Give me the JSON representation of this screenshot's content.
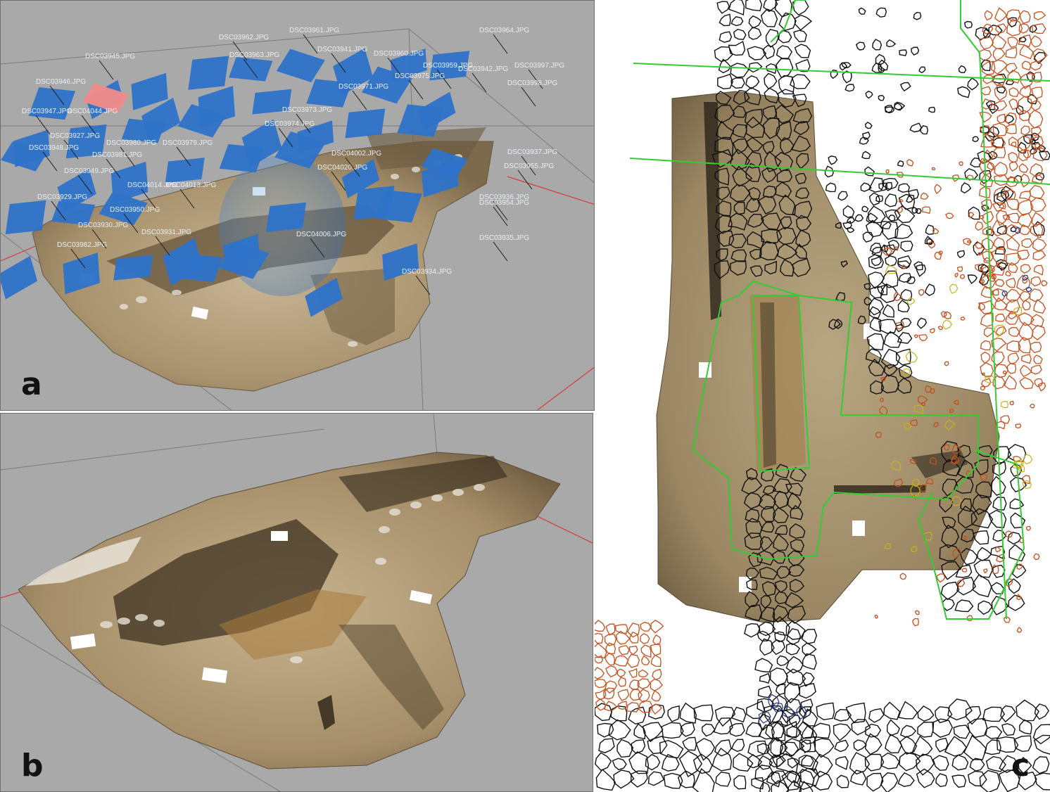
{
  "panels": {
    "a": {
      "label": "a",
      "camera_labels": [
        "DSC03961.JPG",
        "DSC03962.JPG",
        "DSC03963.JPG",
        "DSC03964.JPG",
        "DSC03945.JPG",
        "DSC03941.JPG",
        "DSC03960.JPG",
        "DSC03959.JPG",
        "DSC03997.JPG",
        "DSC03946.JPG",
        "DSC03998.JPG",
        "DSC03971.JPG",
        "DSC03947.JPG",
        "DSC03973.JPG",
        "DSC03974.JPG",
        "DSC03927.JPG",
        "DSC03948.JPG",
        "DSC03979.JPG",
        "DSC03980.JPG",
        "DSC03937.JPG",
        "DSC03981.JPG",
        "DSC03955.JPG",
        "DSC03949.JPG",
        "DSC04013.JPG",
        "DSC04020.JPG",
        "DSC03936.JPG",
        "DSC03929.JPG",
        "DSC03954.JPG",
        "DSC03950.JPG",
        "DSC03931.JPG",
        "DSC04006.JPG",
        "DSC03935.JPG",
        "DSC03982.JPG",
        "DSC03934.JPG",
        "DSC04044.JPG",
        "DSC04002.JPG",
        "DSC03975.JPG",
        "DSC03942.JPG",
        "DSC04014.JPG",
        "DSC03930.JPG"
      ]
    },
    "b": {
      "label": "b"
    },
    "c": {
      "label": "c"
    }
  },
  "colors": {
    "viewport_gray": "#a9a9a9",
    "camera_blue": "#2f73c9",
    "selected_camera": "#f08a8a",
    "ground": "#b39f7c",
    "stone_outline": "#111111",
    "orange_stones": "#c4501c",
    "yellow_stones": "#c9b21a",
    "green_lines": "#33cc33",
    "axis_red": "#d63a3a"
  }
}
